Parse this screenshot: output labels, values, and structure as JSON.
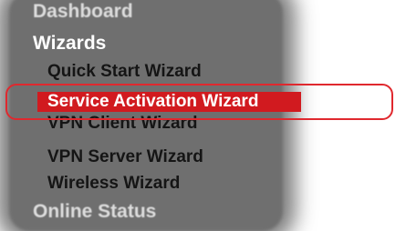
{
  "menu": {
    "dashboard": "Dashboard",
    "wizards": "Wizards",
    "items": [
      "Quick Start Wizard",
      "Service Activation Wizard",
      "VPN Client Wizard",
      "VPN Server Wizard",
      "Wireless Wizard"
    ],
    "online_status": "Online Status",
    "selected_item": "Service Activation Wizard"
  },
  "colors": {
    "panel": "#6f6f6f",
    "highlight": "#d11a1f",
    "annotation_outline": "#e0282e"
  }
}
